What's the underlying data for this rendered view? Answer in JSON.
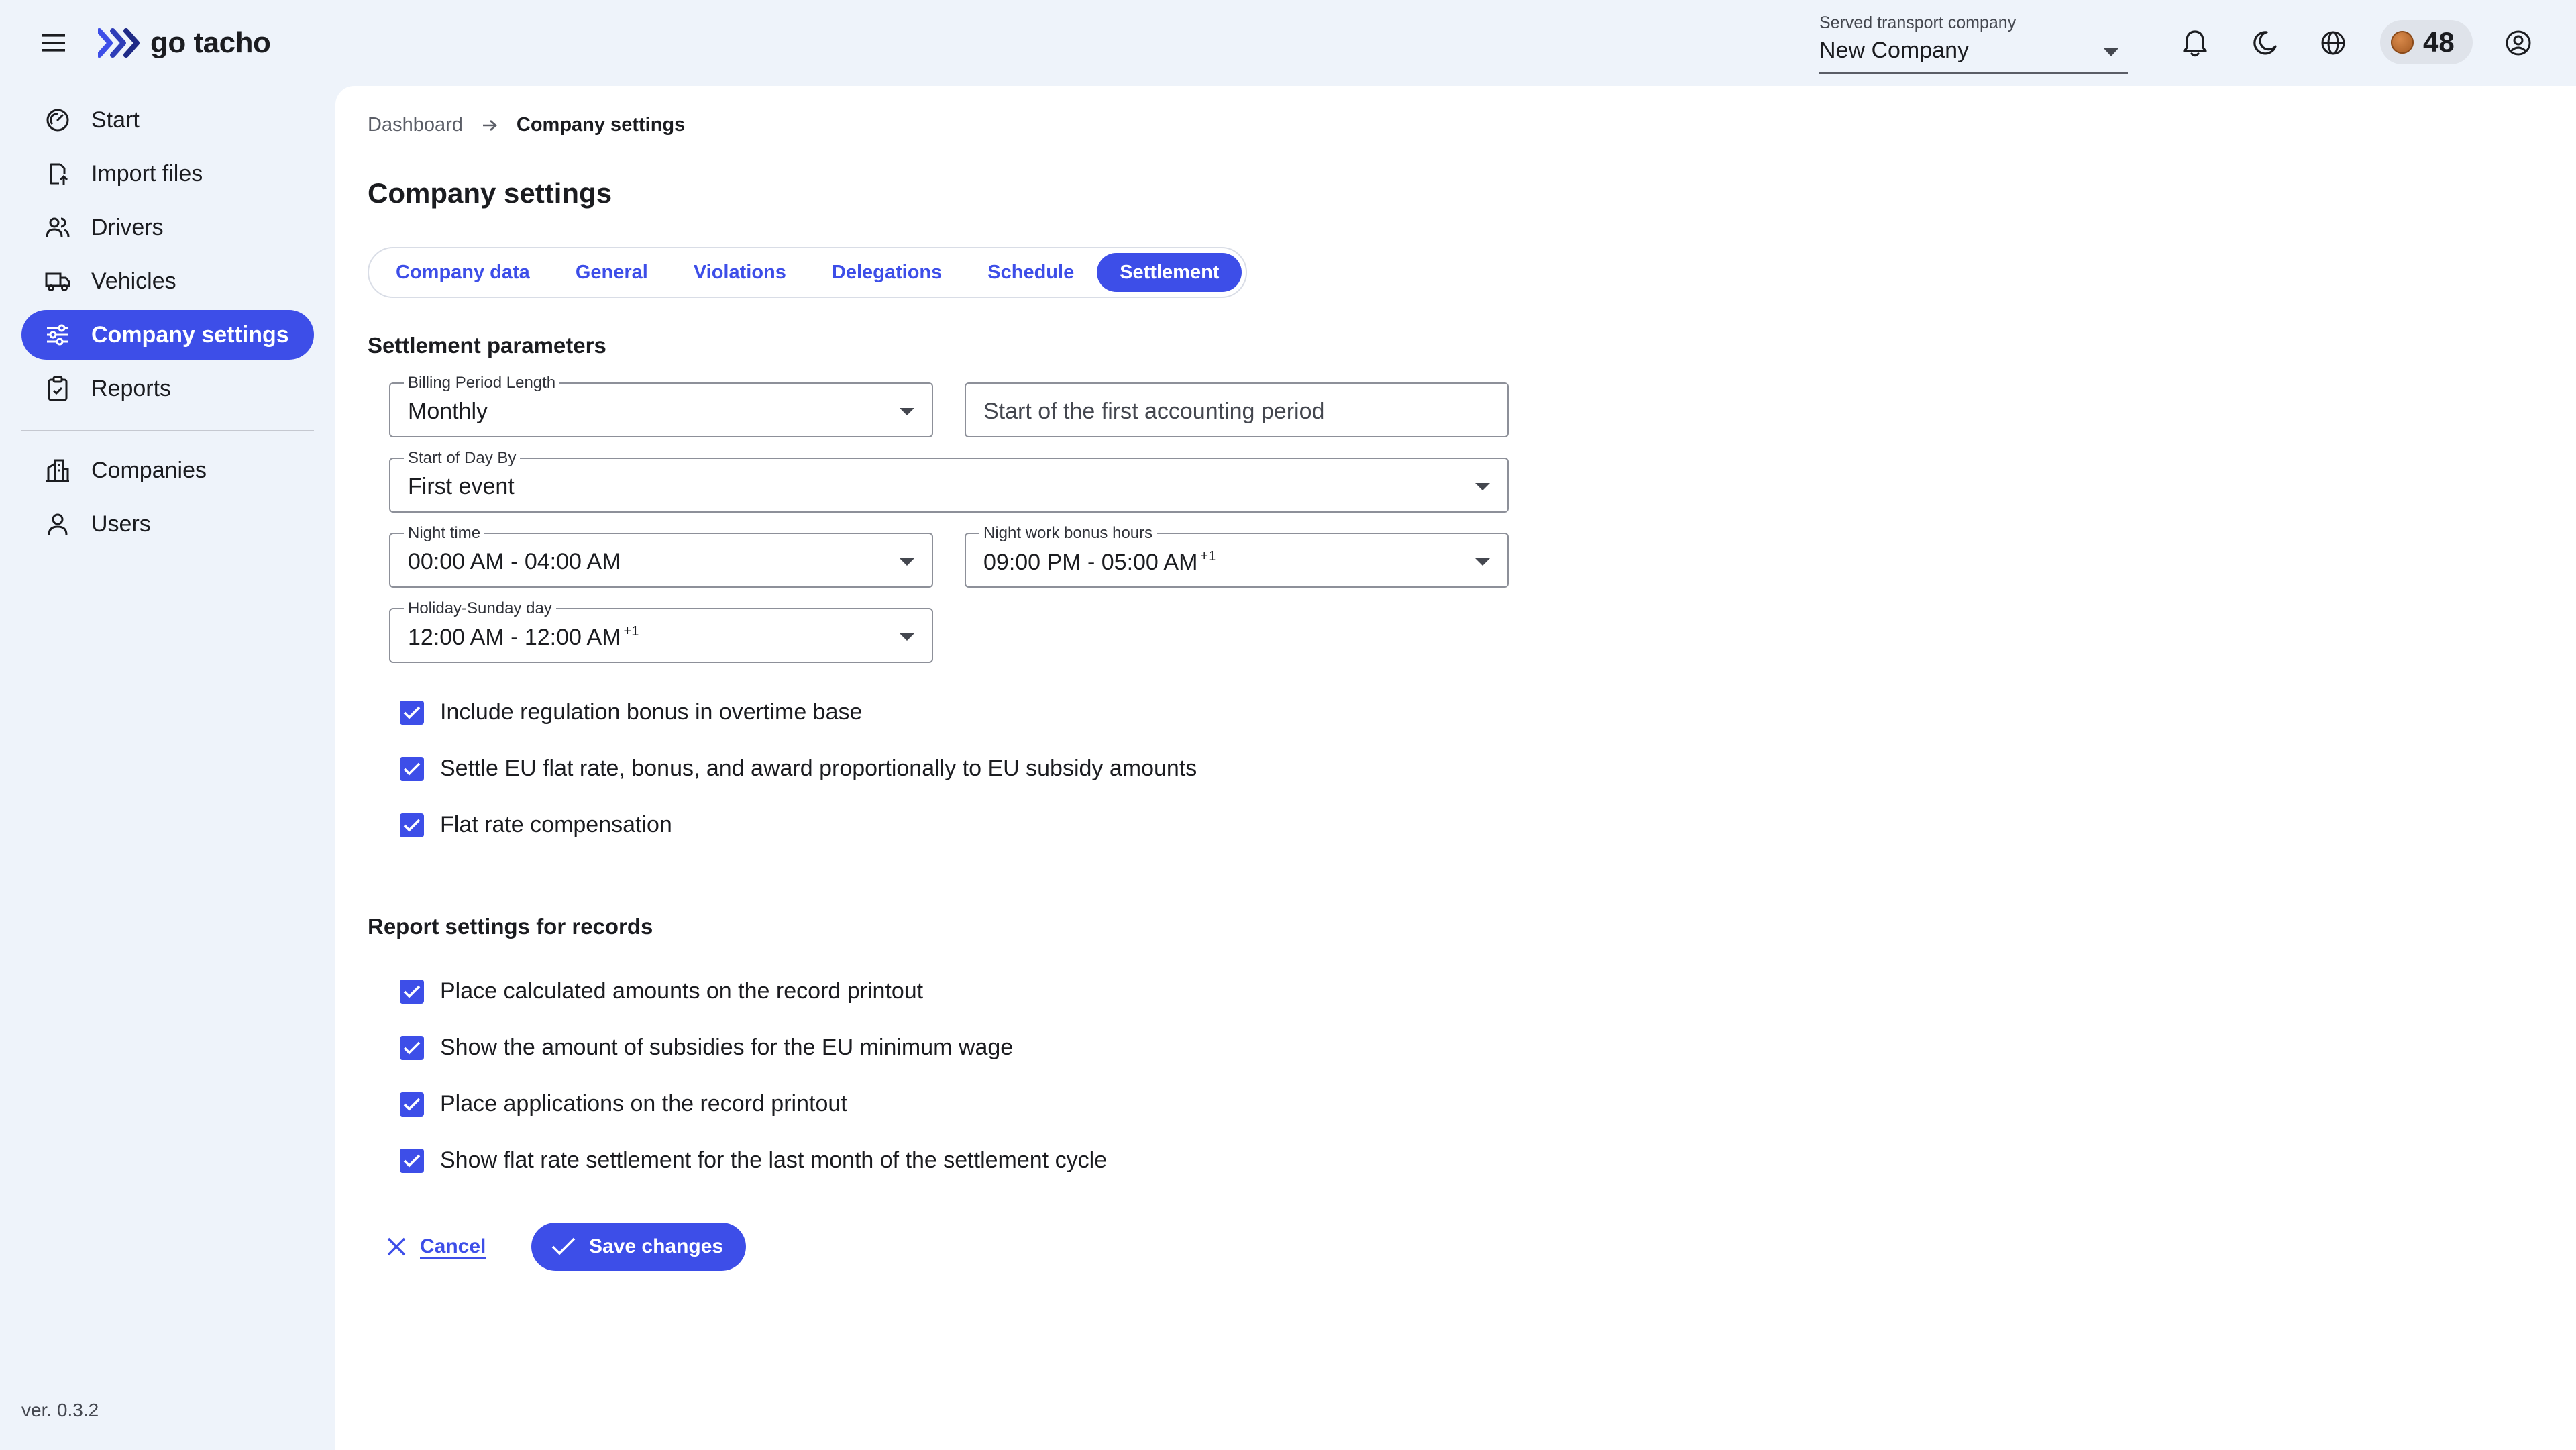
{
  "app": {
    "logo_text": "go tacho",
    "version": "ver. 0.3.2"
  },
  "topbar": {
    "company_select_label": "Served transport company",
    "company_select_value": "New Company",
    "credits": "48",
    "icons": [
      "menu-icon",
      "bell-icon",
      "moon-icon",
      "globe-icon",
      "coin-icon",
      "account-circle-icon"
    ]
  },
  "sidebar": {
    "items": [
      {
        "label": "Start",
        "icon": "speedometer-icon"
      },
      {
        "label": "Import files",
        "icon": "file-import-icon"
      },
      {
        "label": "Drivers",
        "icon": "people-icon"
      },
      {
        "label": "Vehicles",
        "icon": "truck-icon"
      },
      {
        "label": "Company settings",
        "icon": "sliders-icon",
        "active": true
      },
      {
        "label": "Reports",
        "icon": "clipboard-icon"
      },
      {
        "label": "Companies",
        "icon": "building-icon"
      },
      {
        "label": "Users",
        "icon": "user-icon"
      }
    ]
  },
  "breadcrumb": {
    "parent": "Dashboard",
    "current": "Company settings"
  },
  "page_title": "Company settings",
  "tabs": [
    {
      "label": "Company data"
    },
    {
      "label": "General"
    },
    {
      "label": "Violations"
    },
    {
      "label": "Delegations"
    },
    {
      "label": "Schedule"
    },
    {
      "label": "Settlement",
      "active": true
    }
  ],
  "settlement": {
    "section_title": "Settlement parameters",
    "billing_period_label": "Billing Period Length",
    "billing_period_value": "Monthly",
    "first_period_placeholder": "Start of the first accounting period",
    "start_of_day_label": "Start of Day By",
    "start_of_day_value": "First event",
    "night_time_label": "Night time",
    "night_time_value": "00:00 AM - 04:00 AM",
    "night_bonus_label": "Night work bonus hours",
    "night_bonus_value": "09:00 PM - 05:00 AM",
    "night_bonus_suffix": "+1",
    "holiday_label": "Holiday-Sunday day",
    "holiday_value": "12:00 AM - 12:00 AM",
    "holiday_suffix": "+1",
    "checkboxes": [
      {
        "label": "Include regulation bonus in overtime base",
        "checked": true
      },
      {
        "label": "Settle EU flat rate, bonus, and award proportionally to EU subsidy amounts",
        "checked": true
      },
      {
        "label": "Flat rate compensation",
        "checked": true
      }
    ]
  },
  "report_settings": {
    "section_title": "Report settings for records",
    "checkboxes": [
      {
        "label": "Place calculated amounts on the record printout",
        "checked": true
      },
      {
        "label": "Show the amount of subsidies for the EU minimum wage",
        "checked": true
      },
      {
        "label": "Place applications on the record printout",
        "checked": true
      },
      {
        "label": "Show flat rate settlement for the last month of the settlement cycle",
        "checked": true
      }
    ]
  },
  "actions": {
    "cancel_label": "Cancel",
    "save_label": "Save changes"
  },
  "colors": {
    "accent": "#3d4ee8",
    "background": "#eef3fa",
    "surface": "#ffffff"
  }
}
